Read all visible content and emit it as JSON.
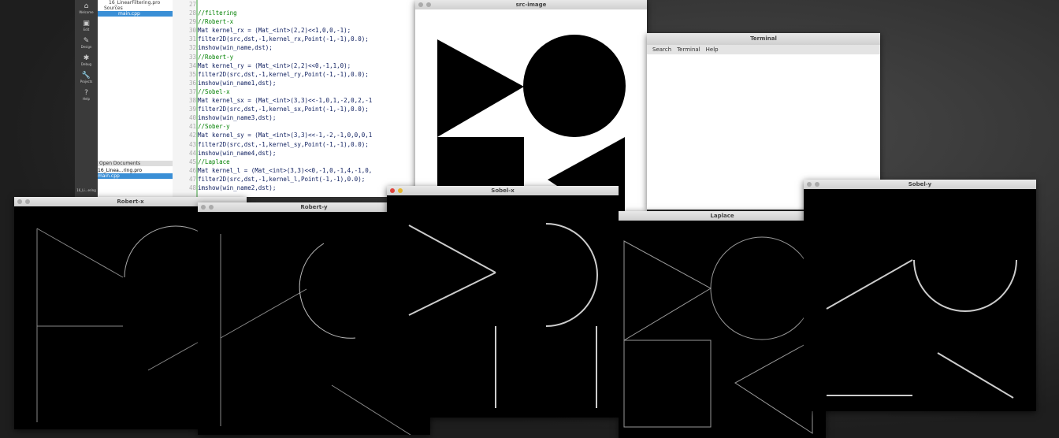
{
  "qt": {
    "sidebar": [
      "Welcome",
      "Edit",
      "Design",
      "Debug",
      "Projects",
      "Help"
    ],
    "tree": {
      "pro": "16_LinearFiltering.pro",
      "sources": "Sources",
      "main": "main.cpp"
    },
    "open_docs_title": "Open Documents",
    "open_docs": [
      "16_Linea...ring.pro",
      "main.cpp"
    ],
    "bottom": "16_Li...ering",
    "line_numbers": [
      "27",
      "28",
      "29",
      "30",
      "31",
      "32",
      "33",
      "34",
      "35",
      "36",
      "37",
      "38",
      "39",
      "40",
      "41",
      "42",
      "43",
      "44",
      "45",
      "46",
      "47",
      "48"
    ],
    "code": [
      "",
      "//filtering",
      "//Robert-x",
      "Mat kernel_rx = (Mat_<int>(2,2)<<1,0,0,-1);",
      "filter2D(src,dst,-1,kernel_rx,Point(-1,-1),0.0);",
      "imshow(win_name,dst);",
      "//Robert-y",
      "Mat kernel_ry = (Mat_<int>(2,2)<<0,-1,1,0);",
      "filter2D(src,dst,-1,kernel_ry,Point(-1,-1),0.0);",
      "imshow(win_name1,dst);",
      "//Sobel-x",
      "Mat kernel_sx = (Mat_<int>(3,3)<<-1,0,1,-2,0,2,-1",
      "filter2D(src,dst,-1,kernel_sx,Point(-1,-1),0.0);",
      "imshow(win_name3,dst);",
      "//Sober-y",
      "Mat kernel_sy = (Mat_<int>(3,3)<<-1,-2,-1,0,0,0,1",
      "filter2D(src,dst,-1,kernel_sy,Point(-1,-1),0.0);",
      "imshow(win_name4,dst);",
      "//Laplace",
      "Mat kernel_l = (Mat_<int>(3,3)<<0,-1,0,-1,4,-1,0,",
      "filter2D(src,dst,-1,kernel_l,Point(-1,-1),0.0);",
      "imshow(win_name2,dst);"
    ]
  },
  "windows": {
    "src": "src-image",
    "terminal": "Terminal",
    "robert_x": "Robert-x",
    "robert_y": "Robert-y",
    "sobel_x": "Sobel-x",
    "laplace": "Laplace",
    "sobel_y": "Sobel-y"
  },
  "terminal_menu": [
    "Search",
    "Terminal",
    "Help"
  ]
}
